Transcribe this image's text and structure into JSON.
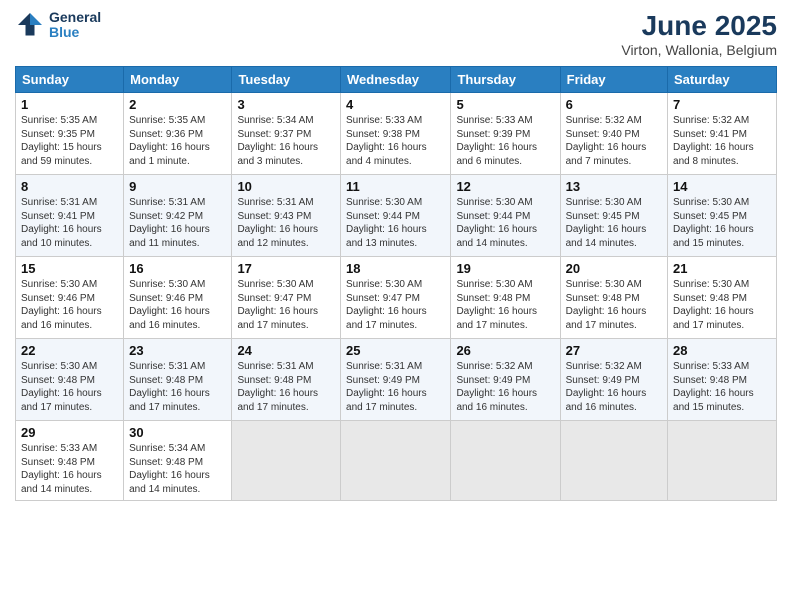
{
  "header": {
    "logo_line1": "General",
    "logo_line2": "Blue",
    "title": "June 2025",
    "subtitle": "Virton, Wallonia, Belgium"
  },
  "days": [
    "Sunday",
    "Monday",
    "Tuesday",
    "Wednesday",
    "Thursday",
    "Friday",
    "Saturday"
  ],
  "weeks": [
    [
      {
        "num": "1",
        "sunrise": "5:35 AM",
        "sunset": "9:35 PM",
        "daylight": "15 hours and 59 minutes."
      },
      {
        "num": "2",
        "sunrise": "5:35 AM",
        "sunset": "9:36 PM",
        "daylight": "16 hours and 1 minute."
      },
      {
        "num": "3",
        "sunrise": "5:34 AM",
        "sunset": "9:37 PM",
        "daylight": "16 hours and 3 minutes."
      },
      {
        "num": "4",
        "sunrise": "5:33 AM",
        "sunset": "9:38 PM",
        "daylight": "16 hours and 4 minutes."
      },
      {
        "num": "5",
        "sunrise": "5:33 AM",
        "sunset": "9:39 PM",
        "daylight": "16 hours and 6 minutes."
      },
      {
        "num": "6",
        "sunrise": "5:32 AM",
        "sunset": "9:40 PM",
        "daylight": "16 hours and 7 minutes."
      },
      {
        "num": "7",
        "sunrise": "5:32 AM",
        "sunset": "9:41 PM",
        "daylight": "16 hours and 8 minutes."
      }
    ],
    [
      {
        "num": "8",
        "sunrise": "5:31 AM",
        "sunset": "9:41 PM",
        "daylight": "16 hours and 10 minutes."
      },
      {
        "num": "9",
        "sunrise": "5:31 AM",
        "sunset": "9:42 PM",
        "daylight": "16 hours and 11 minutes."
      },
      {
        "num": "10",
        "sunrise": "5:31 AM",
        "sunset": "9:43 PM",
        "daylight": "16 hours and 12 minutes."
      },
      {
        "num": "11",
        "sunrise": "5:30 AM",
        "sunset": "9:44 PM",
        "daylight": "16 hours and 13 minutes."
      },
      {
        "num": "12",
        "sunrise": "5:30 AM",
        "sunset": "9:44 PM",
        "daylight": "16 hours and 14 minutes."
      },
      {
        "num": "13",
        "sunrise": "5:30 AM",
        "sunset": "9:45 PM",
        "daylight": "16 hours and 14 minutes."
      },
      {
        "num": "14",
        "sunrise": "5:30 AM",
        "sunset": "9:45 PM",
        "daylight": "16 hours and 15 minutes."
      }
    ],
    [
      {
        "num": "15",
        "sunrise": "5:30 AM",
        "sunset": "9:46 PM",
        "daylight": "16 hours and 16 minutes."
      },
      {
        "num": "16",
        "sunrise": "5:30 AM",
        "sunset": "9:46 PM",
        "daylight": "16 hours and 16 minutes."
      },
      {
        "num": "17",
        "sunrise": "5:30 AM",
        "sunset": "9:47 PM",
        "daylight": "16 hours and 17 minutes."
      },
      {
        "num": "18",
        "sunrise": "5:30 AM",
        "sunset": "9:47 PM",
        "daylight": "16 hours and 17 minutes."
      },
      {
        "num": "19",
        "sunrise": "5:30 AM",
        "sunset": "9:48 PM",
        "daylight": "16 hours and 17 minutes."
      },
      {
        "num": "20",
        "sunrise": "5:30 AM",
        "sunset": "9:48 PM",
        "daylight": "16 hours and 17 minutes."
      },
      {
        "num": "21",
        "sunrise": "5:30 AM",
        "sunset": "9:48 PM",
        "daylight": "16 hours and 17 minutes."
      }
    ],
    [
      {
        "num": "22",
        "sunrise": "5:30 AM",
        "sunset": "9:48 PM",
        "daylight": "16 hours and 17 minutes."
      },
      {
        "num": "23",
        "sunrise": "5:31 AM",
        "sunset": "9:48 PM",
        "daylight": "16 hours and 17 minutes."
      },
      {
        "num": "24",
        "sunrise": "5:31 AM",
        "sunset": "9:48 PM",
        "daylight": "16 hours and 17 minutes."
      },
      {
        "num": "25",
        "sunrise": "5:31 AM",
        "sunset": "9:49 PM",
        "daylight": "16 hours and 17 minutes."
      },
      {
        "num": "26",
        "sunrise": "5:32 AM",
        "sunset": "9:49 PM",
        "daylight": "16 hours and 16 minutes."
      },
      {
        "num": "27",
        "sunrise": "5:32 AM",
        "sunset": "9:49 PM",
        "daylight": "16 hours and 16 minutes."
      },
      {
        "num": "28",
        "sunrise": "5:33 AM",
        "sunset": "9:48 PM",
        "daylight": "16 hours and 15 minutes."
      }
    ],
    [
      {
        "num": "29",
        "sunrise": "5:33 AM",
        "sunset": "9:48 PM",
        "daylight": "16 hours and 14 minutes."
      },
      {
        "num": "30",
        "sunrise": "5:34 AM",
        "sunset": "9:48 PM",
        "daylight": "16 hours and 14 minutes."
      },
      null,
      null,
      null,
      null,
      null
    ]
  ]
}
